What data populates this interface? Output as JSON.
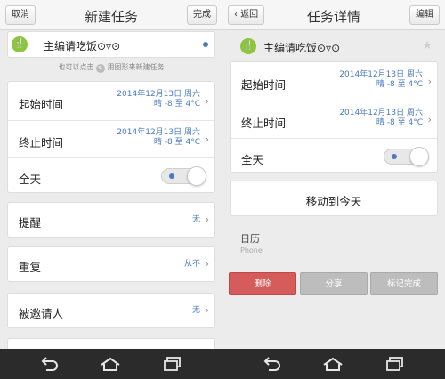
{
  "left": {
    "nav": {
      "cancel": "取消",
      "title": "新建任务",
      "done": "完成"
    },
    "task": {
      "title": "主编请吃饭⊙▿⊙"
    },
    "hint": {
      "before": "也可以点击",
      "after": "用图形来新建任务"
    },
    "start": {
      "label": "起始时间",
      "date": "2014年12月13日 周六",
      "weather": "晴  -8 至 4°C"
    },
    "end": {
      "label": "终止时间",
      "date": "2014年12月13日 周六",
      "weather": "晴  -8 至 4°C"
    },
    "allday": {
      "label": "全天",
      "on": true
    },
    "reminder": {
      "label": "提醒",
      "value": "无"
    },
    "repeat": {
      "label": "重复",
      "value": "从不"
    },
    "invitees": {
      "label": "被邀请人",
      "value": "无"
    }
  },
  "right": {
    "nav": {
      "back": "返回",
      "title": "任务详情",
      "edit": "编辑"
    },
    "task": {
      "title": "主编请吃饭⊙▿⊙"
    },
    "start": {
      "label": "起始时间",
      "date": "2014年12月13日 周六",
      "weather": "晴  -8 至 4°C"
    },
    "end": {
      "label": "终止时间",
      "date": "2014年12月13日 周六",
      "weather": "晴  -8 至 4°C"
    },
    "allday": {
      "label": "全天",
      "on": true
    },
    "move_today": "移动到今天",
    "calendar": {
      "title": "日历",
      "sub": "Phone"
    },
    "actions": {
      "delete": "删除",
      "share": "分享",
      "mark_complete": "标记完成"
    }
  },
  "colors": {
    "accent": "#4a7bbf",
    "delete": "#d65b5b",
    "icon_green": "#8cc63f"
  },
  "icons": {
    "meal": "fork-knife-icon",
    "star": "star-icon",
    "back": "back-icon",
    "home": "home-icon",
    "recents": "recents-icon"
  }
}
